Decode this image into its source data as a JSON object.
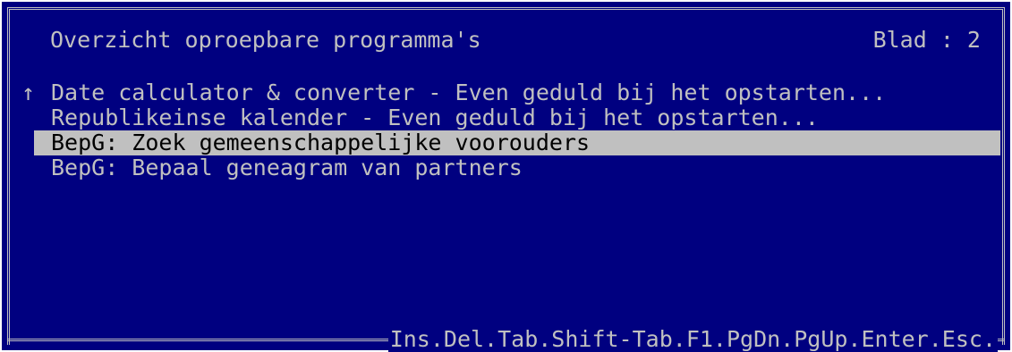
{
  "window": {
    "title": "Overzicht oproepbare programma's",
    "page_indicator": "Blad : 2",
    "scroll_indicator": "↑"
  },
  "menu": {
    "items": [
      {
        "label": "Date calculator & converter - Even geduld bij het opstarten..."
      },
      {
        "label": "Republikeinse kalender - Even geduld bij het opstarten..."
      },
      {
        "label": "BepG: Zoek gemeenschappelijke voorouders"
      },
      {
        "label": "BepG: Bepaal geneagram van partners"
      }
    ],
    "selected_index": 2
  },
  "footer": {
    "keys": "Ins.Del.Tab.Shift-Tab.F1.PgDn.PgUp.Enter.Esc."
  },
  "colors": {
    "background": "#000080",
    "text": "#c0c0c0",
    "highlight_bg": "#c0c0c0",
    "highlight_text": "#000000"
  }
}
